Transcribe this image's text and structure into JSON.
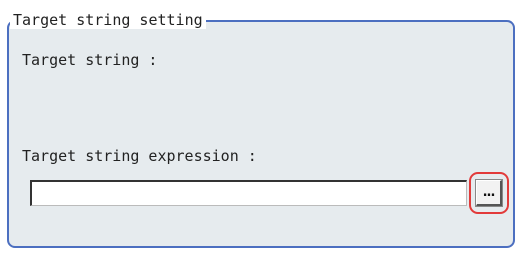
{
  "group": {
    "title": "Target string setting"
  },
  "fields": {
    "target_string_label": "Target string :",
    "target_string_value": "",
    "expression_label": "Target string expression :",
    "expression_value": ""
  },
  "buttons": {
    "browse_label": "..."
  },
  "colors": {
    "panel_bg": "#e6ebee",
    "panel_border": "#4c6fc0",
    "highlight": "#e23a3a"
  }
}
